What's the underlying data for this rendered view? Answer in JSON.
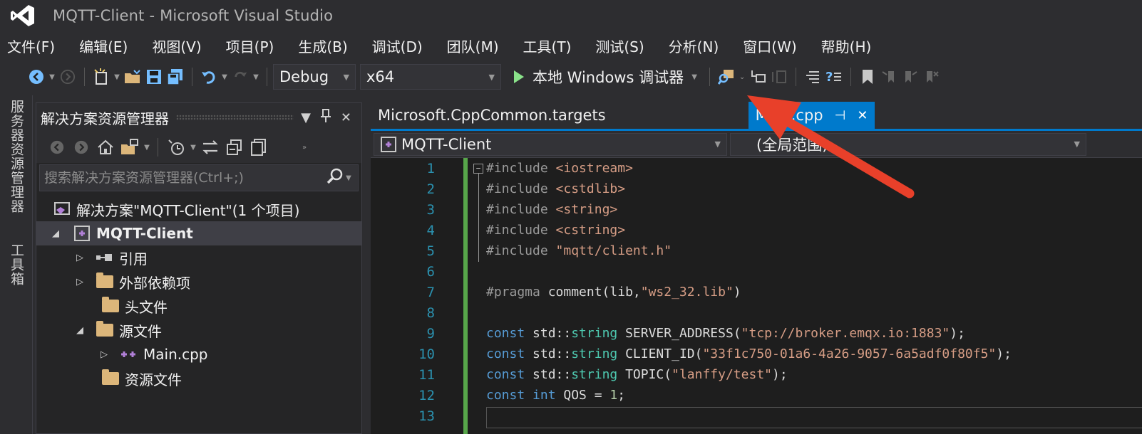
{
  "window": {
    "title": "MQTT-Client - Microsoft Visual Studio"
  },
  "menu": [
    "文件(F)",
    "编辑(E)",
    "视图(V)",
    "项目(P)",
    "生成(B)",
    "调试(D)",
    "团队(M)",
    "工具(T)",
    "测试(S)",
    "分析(N)",
    "窗口(W)",
    "帮助(H)"
  ],
  "toolbar": {
    "config": "Debug",
    "platform": "x64",
    "run_label": "本地 Windows 调试器"
  },
  "side_tabs": [
    "服务器资源管理器",
    "工具箱"
  ],
  "solution_explorer": {
    "title": "解决方案资源管理器",
    "search_placeholder": "搜索解决方案资源管理器(Ctrl+;)",
    "tree": [
      {
        "label": "解决方案\"MQTT-Client\"(1 个项目)"
      },
      {
        "label": "MQTT-Client"
      },
      {
        "label": "引用"
      },
      {
        "label": "外部依赖项"
      },
      {
        "label": "头文件"
      },
      {
        "label": "源文件"
      },
      {
        "label": "Main.cpp"
      },
      {
        "label": "资源文件"
      }
    ]
  },
  "editor": {
    "tabs": [
      "Microsoft.CppCommon.targets",
      "Main.cpp"
    ],
    "nav_left": "MQTT-Client",
    "nav_right": "(全局范围)",
    "line_numbers": [
      "1",
      "2",
      "3",
      "4",
      "5",
      "6",
      "7",
      "8",
      "9",
      "10",
      "11",
      "12",
      "13"
    ],
    "lines": {
      "l1": {
        "pp": "#include ",
        "str": "<iostream>"
      },
      "l2": {
        "pp": "#include ",
        "str": "<cstdlib>"
      },
      "l3": {
        "pp": "#include ",
        "str": "<string>"
      },
      "l4": {
        "pp": "#include ",
        "str": "<cstring>"
      },
      "l5": {
        "pp": "#include ",
        "str": "\"mqtt/client.h\""
      },
      "l7": {
        "pp": "#pragma ",
        "tx": "comment(lib,",
        "str": "\"ws2_32.lib\"",
        "tx2": ")"
      },
      "l9": {
        "kw": "const",
        "ns": " std::",
        "ty": "string",
        "tx": " SERVER_ADDRESS(",
        "str": "\"tcp://broker.emqx.io:1883\"",
        "tx2": ");"
      },
      "l10": {
        "kw": "const",
        "ns": " std::",
        "ty": "string",
        "tx": " CLIENT_ID(",
        "str": "\"33f1c750-01a6-4a26-9057-6a5adf0f80f5\"",
        "tx2": ");"
      },
      "l11": {
        "kw": "const",
        "ns": " std::",
        "ty": "string",
        "tx": " TOPIC(",
        "str": "\"lanffy/test\"",
        "tx2": ");"
      },
      "l12": {
        "kw": "const",
        "kw2": " int",
        "tx": " QOS = ",
        "num": "1",
        "tx2": ";"
      }
    }
  },
  "colors": {
    "accent": "#007acc",
    "arrow": "#e8402a",
    "play": "#8ae28a"
  }
}
